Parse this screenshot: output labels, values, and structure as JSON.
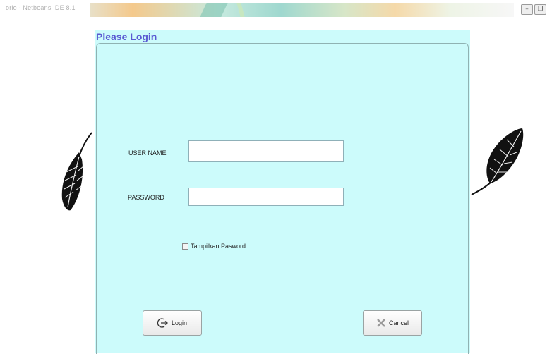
{
  "window": {
    "title": "orio - Netbeans IDE 8.1",
    "minimize_glyph": "–",
    "restore_glyph": "❐"
  },
  "login": {
    "title": "Please Login",
    "username_label": "USER NAME",
    "username_value": "",
    "password_label": "PASSWORD",
    "password_value": "",
    "show_password_label": "Tampilkan Pasword",
    "show_password_checked": false,
    "login_button": "Login",
    "cancel_button": "Cancel"
  },
  "icons": {
    "login_icon": "login-arrow-icon",
    "cancel_icon": "x-icon",
    "feather_left": "feather-icon",
    "feather_right": "feather-icon"
  },
  "colors": {
    "panel_bg": "#ccfbfb",
    "title_color": "#5a5ad2"
  }
}
